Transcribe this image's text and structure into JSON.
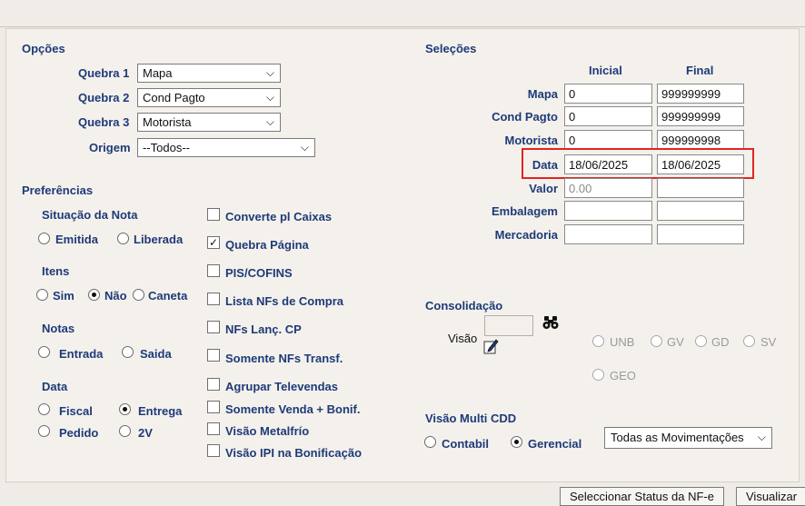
{
  "opcoes": {
    "title": "Opções",
    "quebra1": {
      "label": "Quebra 1",
      "value": "Mapa"
    },
    "quebra2": {
      "label": "Quebra 2",
      "value": "Cond Pagto"
    },
    "quebra3": {
      "label": "Quebra 3",
      "value": "Motorista"
    },
    "origem": {
      "label": "Origem",
      "value": "--Todos--"
    }
  },
  "selecoes": {
    "title": "Seleções",
    "col_inicial": "Inicial",
    "col_final": "Final",
    "rows": [
      {
        "label": "Mapa",
        "inicial": "0",
        "final": "999999999"
      },
      {
        "label": "Cond Pagto",
        "inicial": "0",
        "final": "999999999"
      },
      {
        "label": "Motorista",
        "inicial": "0",
        "final": "999999998"
      },
      {
        "label": "Data",
        "inicial": "18/06/2025",
        "final": "18/06/2025"
      },
      {
        "label": "Valor",
        "inicial": "0.00",
        "final": ""
      },
      {
        "label": "Embalagem",
        "inicial": "",
        "final": ""
      },
      {
        "label": "Mercadoria",
        "inicial": "",
        "final": ""
      }
    ]
  },
  "preferencias": {
    "title": "Preferências",
    "situacao": {
      "title": "Situação da Nota",
      "opt1": "Emitida",
      "opt2": "Liberada"
    },
    "itens": {
      "title": "Itens",
      "opt1": "Sim",
      "opt2": "Não",
      "opt3": "Caneta",
      "selected": "Não"
    },
    "notas": {
      "title": "Notas",
      "opt1": "Entrada",
      "opt2": "Saida"
    },
    "data": {
      "title": "Data",
      "opt1": "Fiscal",
      "opt2": "Entrega",
      "opt3": "Pedido",
      "opt4": "2V",
      "selected": "Entrega"
    },
    "checks": [
      {
        "label": "Converte pl Caixas",
        "checked": false
      },
      {
        "label": "Quebra Página",
        "checked": true
      },
      {
        "label": "PIS/COFINS",
        "checked": false
      },
      {
        "label": "Lista NFs de Compra",
        "checked": false
      },
      {
        "label": "NFs Lanç. CP",
        "checked": false
      },
      {
        "label": "Somente NFs Transf.",
        "checked": false
      },
      {
        "label": "Agrupar Televendas",
        "checked": false
      },
      {
        "label": "Somente Venda + Bonif.",
        "checked": false
      },
      {
        "label": "Visão Metalfrío",
        "checked": false
      },
      {
        "label": "Visão IPI na Bonificação",
        "checked": false
      }
    ]
  },
  "consolidacao": {
    "title": "Consolidação",
    "visao_label": "Visão",
    "visao_value": "",
    "options": [
      "UNB",
      "GV",
      "GD",
      "SV",
      "GEO"
    ]
  },
  "visao_multi": {
    "title": "Visão Multi CDD",
    "opt1": "Contabil",
    "opt2": "Gerencial",
    "selected": "Gerencial",
    "dropdown": "Todas as Movimentações"
  },
  "footer": {
    "status_button": "Seleccionar Status  da NF-e",
    "visualizar_button": "Visualizar"
  },
  "icons": {
    "binoculars": "binoculars-icon",
    "pencil": "pencil-icon"
  },
  "colors": {
    "label": "#1e3a78",
    "highlight": "#e02424"
  }
}
